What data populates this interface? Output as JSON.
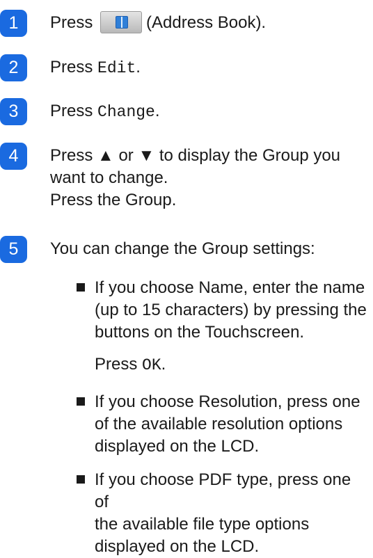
{
  "steps": [
    {
      "number": "1",
      "press": "Press",
      "icon": "address-book-icon",
      "label": "(Address Book)."
    },
    {
      "number": "2",
      "press": "Press",
      "code": "Edit",
      "end": "."
    },
    {
      "number": "3",
      "press": "Press",
      "code": "Change",
      "end": "."
    },
    {
      "number": "4",
      "line1": "Press ▲ or ▼ to display the Group you",
      "line2": "want to change.",
      "line3": "Press the Group."
    },
    {
      "number": "5",
      "text": "You can change the Group settings:"
    }
  ],
  "bullets": [
    {
      "line1": "If you choose Name, enter the name",
      "line2": "(up to 15 characters) by pressing the",
      "line3": "buttons on the Touchscreen."
    },
    {
      "line1": "If you choose Resolution, press one",
      "line2": "of the available resolution options",
      "line3": "displayed on the LCD."
    },
    {
      "line1": "If you choose PDF type, press one of",
      "line2": "the available file type options",
      "line3": "displayed on the LCD."
    }
  ],
  "press_ok": {
    "press": "Press",
    "code": "OK",
    "end": "."
  },
  "colors": {
    "step_badge": "#1a6ae0",
    "text": "#1a1a1a",
    "button_face": "#d0d0d0",
    "book_icon": "#2f7fd8"
  }
}
